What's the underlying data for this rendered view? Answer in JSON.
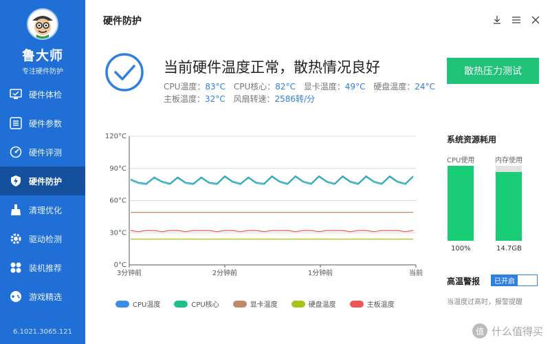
{
  "app": {
    "name": "鲁大师",
    "subtitle": "专注硬件防护",
    "version": "6.1021.3065.121",
    "avatar_icon": "mascot-avatar-icon"
  },
  "nav": [
    {
      "label": "硬件体检",
      "icon": "monitor-check-icon",
      "active": false
    },
    {
      "label": "硬件参数",
      "icon": "list-icon",
      "active": false
    },
    {
      "label": "硬件评测",
      "icon": "speedometer-icon",
      "active": false
    },
    {
      "label": "硬件防护",
      "icon": "shield-icon",
      "active": true
    },
    {
      "label": "清理优化",
      "icon": "broom-icon",
      "active": false
    },
    {
      "label": "驱动检测",
      "icon": "gear-icon",
      "active": false
    },
    {
      "label": "装机推荐",
      "icon": "flower-icon",
      "active": false
    },
    {
      "label": "游戏精选",
      "icon": "gamepad-icon",
      "active": false
    }
  ],
  "header": {
    "title": "硬件防护",
    "controls": [
      "download-icon",
      "menu-icon",
      "close-icon"
    ]
  },
  "status": {
    "heading": "当前硬件温度正常，散热情况良好",
    "cpu_temp_label": "CPU温度：",
    "cpu_temp": "83°C",
    "cpu_core_label": "CPU核心：",
    "cpu_core": "82°C",
    "gpu_temp_label": "显卡温度：",
    "gpu_temp": "49°C",
    "disk_temp_label": "硬盘温度：",
    "disk_temp": "24°C",
    "board_temp_label": "主板温度：",
    "board_temp": "32°C",
    "fan_label": "风扇转速：",
    "fan_speed": "2586转/分",
    "stress_button": "散热压力测试"
  },
  "chart_data": {
    "type": "line",
    "ylim": [
      0,
      120
    ],
    "yticks": [
      "0°C",
      "30°C",
      "60°C",
      "90°C",
      "120°C"
    ],
    "x_labels": [
      "3分钟前",
      "2分钟前",
      "1分钟前",
      "当前"
    ],
    "series": [
      {
        "name": "CPU温度",
        "color": "#3a8ee6",
        "values": [
          80,
          77,
          76,
          82,
          78,
          76,
          82,
          77,
          76,
          82,
          77,
          76,
          83,
          78,
          76,
          82,
          77,
          76,
          83,
          78,
          76,
          83,
          78,
          76,
          83,
          78,
          76,
          83,
          78,
          76,
          83,
          78,
          76,
          83,
          78,
          76,
          83
        ]
      },
      {
        "name": "CPU核心",
        "color": "#1fbf8a",
        "values": [
          79,
          76,
          75,
          81,
          77,
          75,
          81,
          76,
          75,
          81,
          76,
          75,
          82,
          77,
          75,
          81,
          76,
          75,
          82,
          77,
          75,
          82,
          77,
          75,
          82,
          77,
          75,
          82,
          77,
          75,
          82,
          77,
          75,
          82,
          77,
          75,
          82
        ]
      },
      {
        "name": "显卡温度",
        "color": "#c08a6a",
        "values": [
          49,
          49,
          49,
          49,
          49,
          49,
          49,
          49,
          49,
          49,
          49,
          49,
          49,
          49,
          49,
          49,
          49,
          49,
          49,
          49,
          49,
          49,
          49,
          49,
          49,
          49,
          49,
          49,
          49,
          49,
          49,
          49,
          49,
          49,
          49,
          49,
          49
        ]
      },
      {
        "name": "硬盘温度",
        "color": "#a8c21a",
        "values": [
          24,
          24,
          24,
          24,
          24,
          24,
          24,
          24,
          24,
          24,
          24,
          24,
          24,
          24,
          24,
          24,
          24,
          24,
          24,
          24,
          24,
          24,
          24,
          24,
          24,
          24,
          24,
          24,
          24,
          24,
          24,
          24,
          24,
          24,
          24,
          24,
          24
        ]
      },
      {
        "name": "主板温度",
        "color": "#ee5555",
        "values": [
          32,
          31,
          32,
          32,
          31,
          32,
          32,
          31,
          32,
          32,
          32,
          31,
          32,
          32,
          31,
          32,
          32,
          31,
          32,
          32,
          32,
          31,
          32,
          32,
          31,
          32,
          32,
          32,
          31,
          32,
          32,
          31,
          32,
          32,
          32,
          31,
          32
        ]
      }
    ],
    "legend_position": "bottom",
    "grid": true
  },
  "resources": {
    "title": "系统资源耗用",
    "cpu_label": "CPU使用",
    "cpu_value": "100%",
    "cpu_fraction": 1.0,
    "mem_label": "内存使用",
    "mem_value": "14.7GB",
    "mem_fraction": 0.92
  },
  "alarm": {
    "title": "高温警报",
    "toggle_label": "已开启",
    "note": "当温度过高时，报警提醒"
  },
  "watermark": {
    "circle": "值",
    "text": "什么值得买"
  }
}
